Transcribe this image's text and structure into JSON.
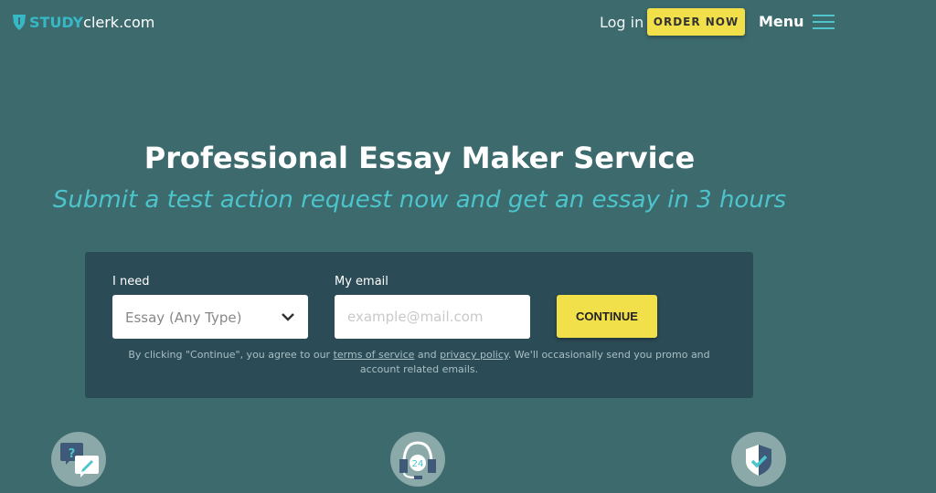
{
  "header": {
    "logo": {
      "brand_part1": "STUDY",
      "brand_part2": "clerk.com"
    },
    "login_label": "Log in",
    "order_now_label": "ORDER NOW",
    "menu_label": "Menu"
  },
  "hero": {
    "title": "Professional Essay Maker Service",
    "subtitle": "Submit a test action request now and get an essay in 3 hours"
  },
  "form": {
    "need_label": "I need",
    "need_value": "Essay (Any Type)",
    "email_label": "My email",
    "email_placeholder": "example@mail.com",
    "email_value": "",
    "continue_label": "CONTINUE",
    "disclaimer_prefix": "By clicking \"Continue\", you agree to our ",
    "terms_link": "terms of service",
    "disclaimer_and": " and ",
    "privacy_link": "privacy policy",
    "disclaimer_suffix": ". We'll occasionally send you promo and account related emails."
  },
  "features": [
    {
      "icon": "question-chat-icon"
    },
    {
      "icon": "support-24-icon",
      "text": "24"
    },
    {
      "icon": "shield-check-icon"
    }
  ],
  "colors": {
    "background": "#3d6a6d",
    "panel": "#2b4b56",
    "accent_yellow": "#f2e04a",
    "accent_teal": "#4cc4cc"
  }
}
